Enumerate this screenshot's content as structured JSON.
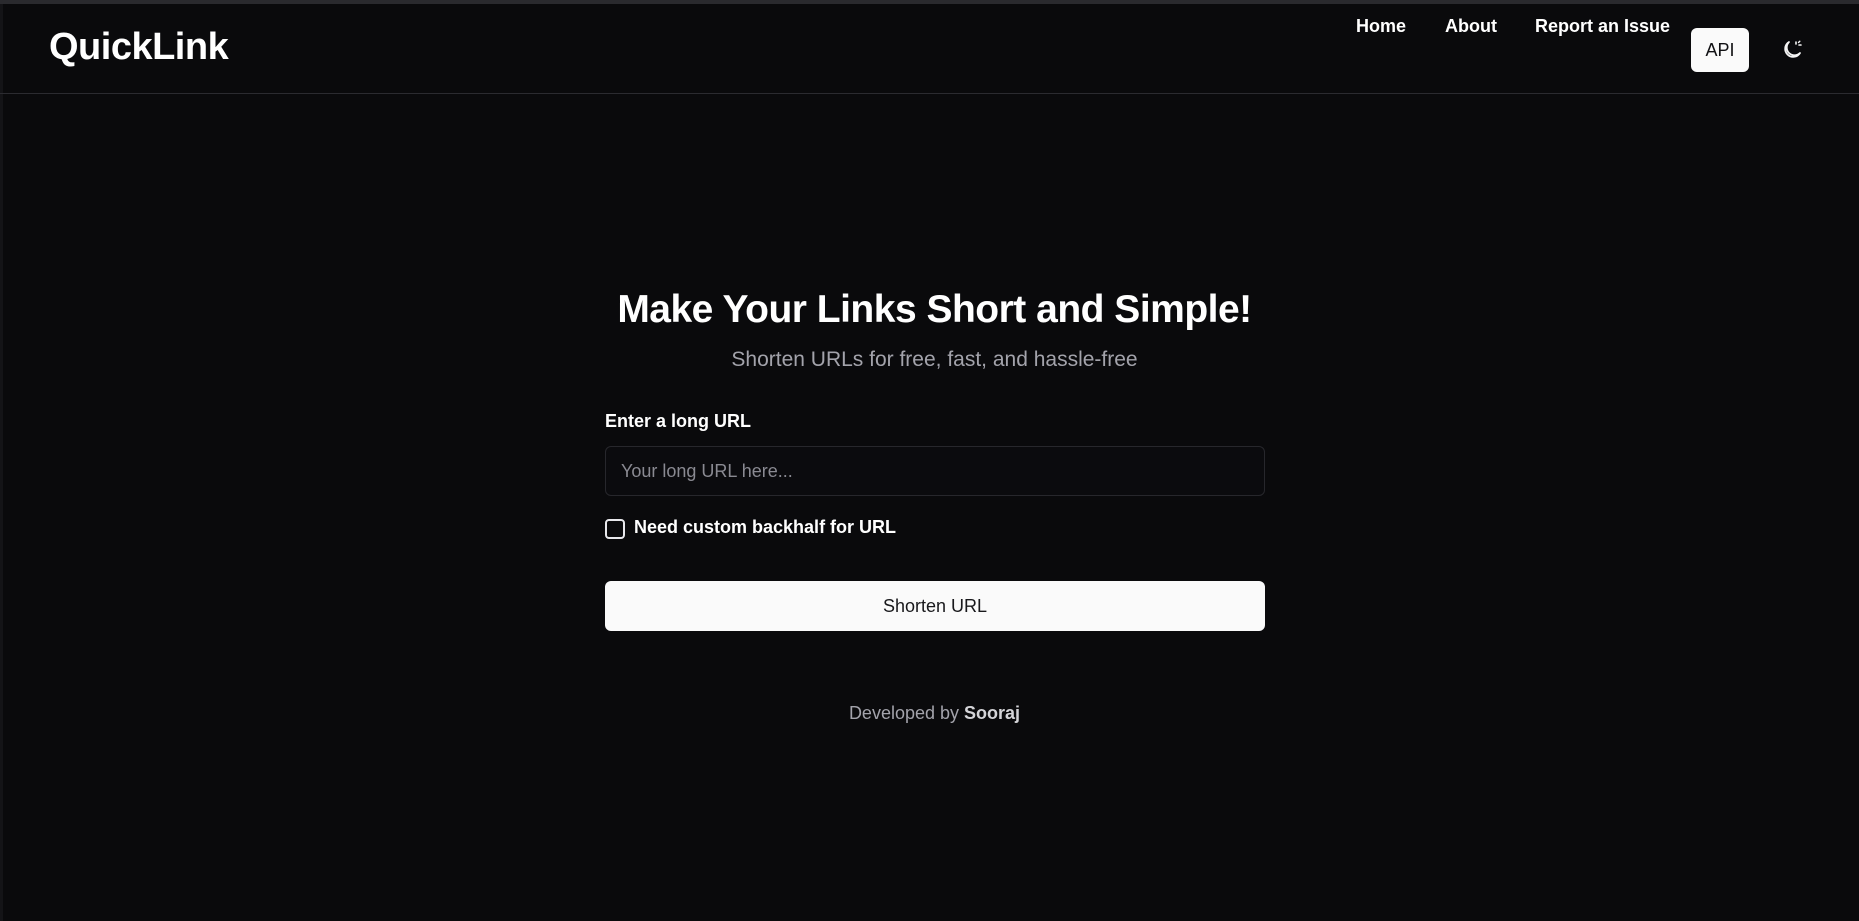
{
  "header": {
    "logo": "QuickLink",
    "nav": {
      "home": "Home",
      "about": "About",
      "report": "Report an Issue",
      "api": "API"
    },
    "theme_toggle_icon": "moon-sun-toggle-icon"
  },
  "hero": {
    "title": "Make Your Links Short and Simple!",
    "subtitle": "Shorten URLs for free, fast, and hassle-free"
  },
  "form": {
    "url_label": "Enter a long URL",
    "url_value": "",
    "url_placeholder": "Your long URL here...",
    "custom_backhalf_label": "Need custom backhalf for URL",
    "custom_backhalf_checked": false,
    "submit_label": "Shorten URL"
  },
  "footer": {
    "credit_prefix": "Developed by",
    "credit_name": "Sooraj"
  },
  "colors": {
    "background": "#0a0a0c",
    "primary_button": "#fafafa",
    "muted_text": "#a3a3ab"
  }
}
